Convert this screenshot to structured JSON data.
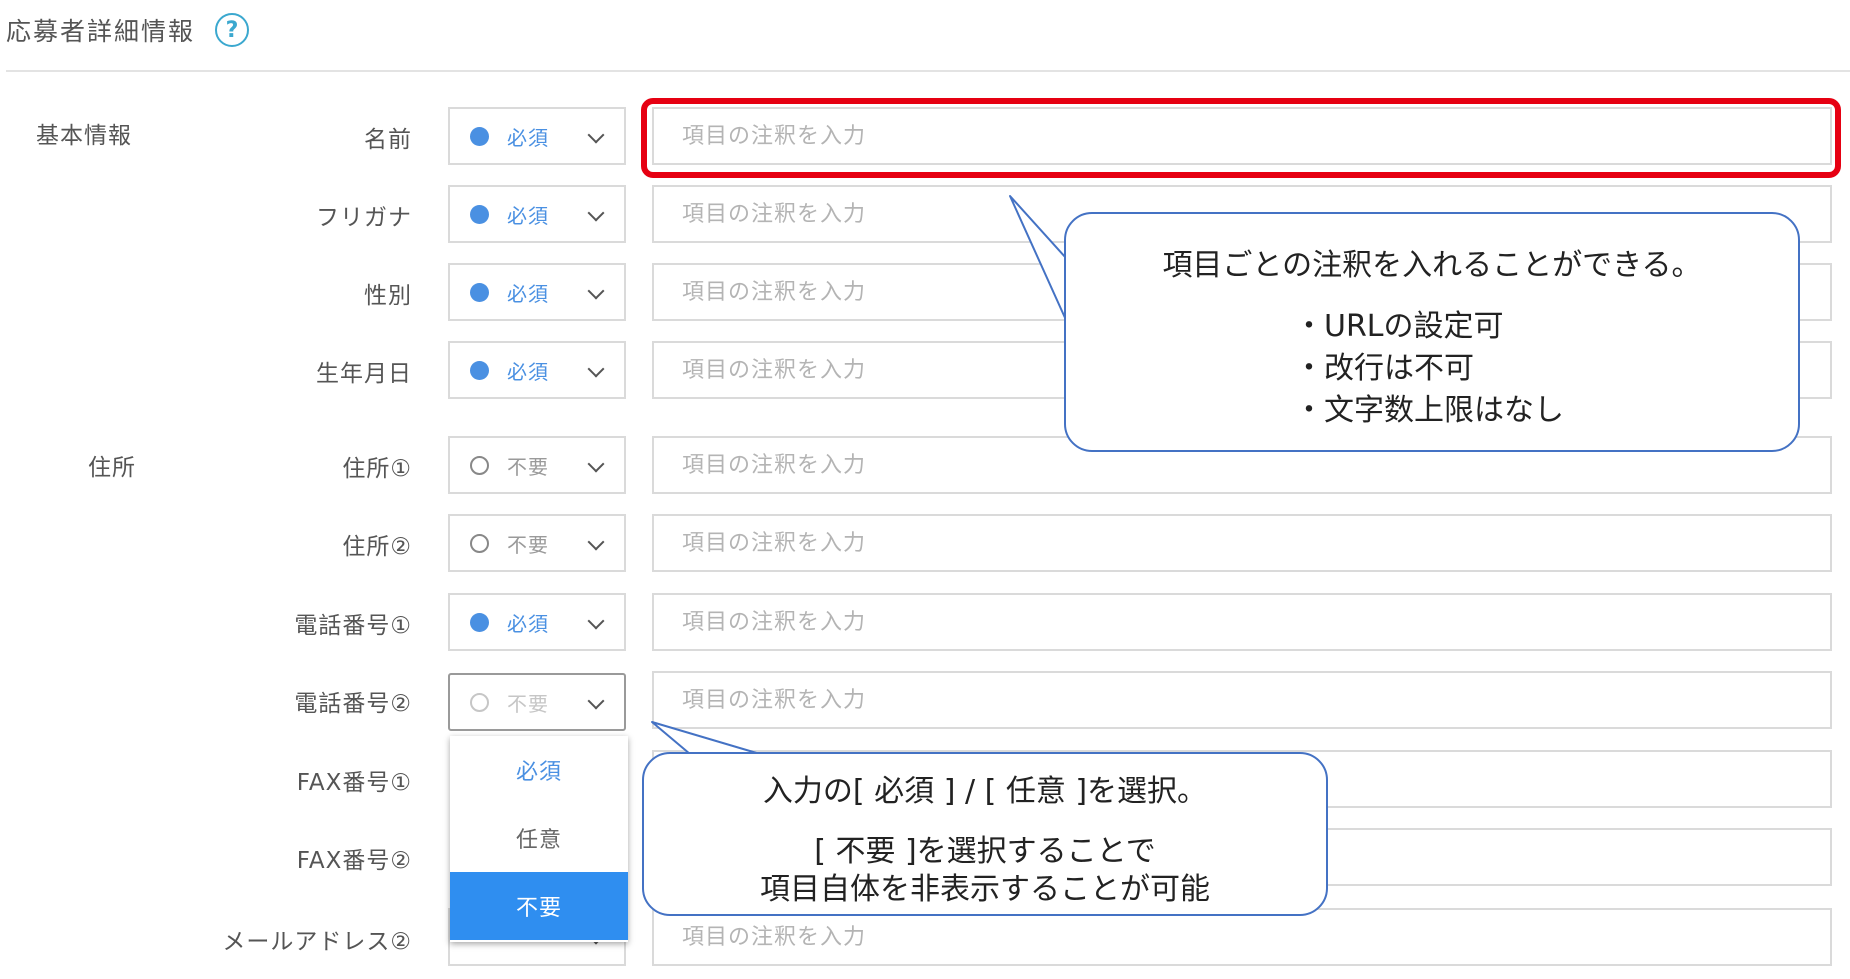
{
  "header": {
    "title": "応募者詳細情報",
    "help": "?"
  },
  "groups": {
    "basic": "基本情報",
    "address": "住所"
  },
  "rows": [
    {
      "label": "名前",
      "state": "必須",
      "filled": true,
      "placeholder": "項目の注釈を入力"
    },
    {
      "label": "フリガナ",
      "state": "必須",
      "filled": true,
      "placeholder": "項目の注釈を入力"
    },
    {
      "label": "性別",
      "state": "必須",
      "filled": true,
      "placeholder": "項目の注釈を入力"
    },
    {
      "label": "生年月日",
      "state": "必須",
      "filled": true,
      "placeholder": "項目の注釈を入力"
    },
    {
      "label": "住所①",
      "state": "不要",
      "filled": false,
      "placeholder": "項目の注釈を入力"
    },
    {
      "label": "住所②",
      "state": "不要",
      "filled": false,
      "placeholder": "項目の注釈を入力"
    },
    {
      "label": "電話番号①",
      "state": "必須",
      "filled": true,
      "placeholder": "項目の注釈を入力"
    },
    {
      "label": "電話番号②",
      "state": "不要",
      "filled": false,
      "placeholder": "項目の注釈を入力"
    },
    {
      "label": "FAX番号①",
      "state": "",
      "filled": false,
      "placeholder": ""
    },
    {
      "label": "FAX番号②",
      "state": "",
      "filled": false,
      "placeholder": ""
    },
    {
      "label": "メールアドレス②",
      "state": "",
      "filled": false,
      "placeholder": "項目の注釈を入力"
    }
  ],
  "dropdown": {
    "options": [
      "必須",
      "任意",
      "不要"
    ],
    "selected": "不要"
  },
  "callouts": {
    "annotation": {
      "heading": "項目ごとの注釈を入れることができる。",
      "items": [
        "・URLの設定可",
        "・改行は不可",
        "・文字数上限はなし"
      ]
    },
    "requirement": {
      "line1": "入力の[ 必須 ] / [ 任意 ]を選択。",
      "line2": "[ 不要 ]を選択することで",
      "line3": "項目自体を非表示することが可能"
    }
  },
  "colors": {
    "accent": "#4a90e2",
    "highlight": "#e60012",
    "callout_border": "#4472c4",
    "selected": "#2f8ef0"
  }
}
